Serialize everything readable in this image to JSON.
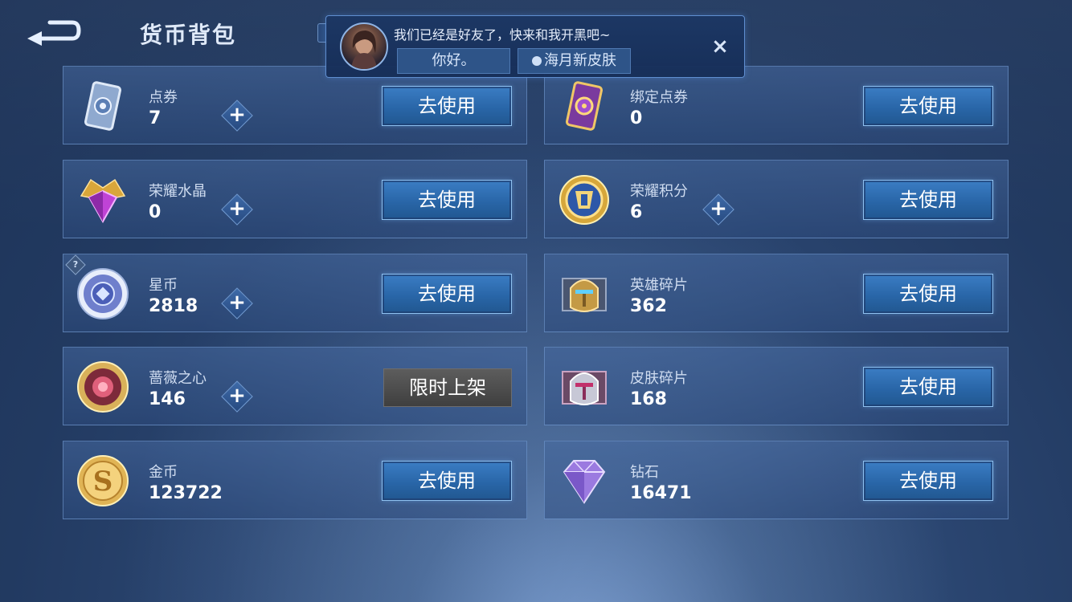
{
  "header": {
    "title": "货币背包"
  },
  "popup": {
    "message": "我们已经是好友了，快来和我开黑吧~",
    "reply_1": "你好。",
    "reply_2": "海月新皮肤",
    "close_label": "×"
  },
  "currencies": [
    {
      "name": "点券",
      "amount": "7",
      "action": "去使用",
      "has_plus": true
    },
    {
      "name": "绑定点券",
      "amount": "0",
      "action": "去使用",
      "has_plus": false
    },
    {
      "name": "荣耀水晶",
      "amount": "0",
      "action": "去使用",
      "has_plus": true
    },
    {
      "name": "荣耀积分",
      "amount": "6",
      "action": "去使用",
      "has_plus": true
    },
    {
      "name": "星币",
      "amount": "2818",
      "action": "去使用",
      "has_plus": true,
      "help": "?"
    },
    {
      "name": "英雄碎片",
      "amount": "362",
      "action": "去使用",
      "has_plus": false
    },
    {
      "name": "蔷薇之心",
      "amount": "146",
      "action": "限时上架",
      "has_plus": true
    },
    {
      "name": "皮肤碎片",
      "amount": "168",
      "action": "去使用",
      "has_plus": false
    },
    {
      "name": "金币",
      "amount": "123722",
      "action": "去使用",
      "has_plus": false
    },
    {
      "name": "钻石",
      "amount": "16471",
      "action": "去使用",
      "has_plus": false
    }
  ],
  "colors": {
    "button_blue": "#2966a8",
    "button_disabled": "#4f4f4f",
    "card_bg": "#36598f"
  }
}
